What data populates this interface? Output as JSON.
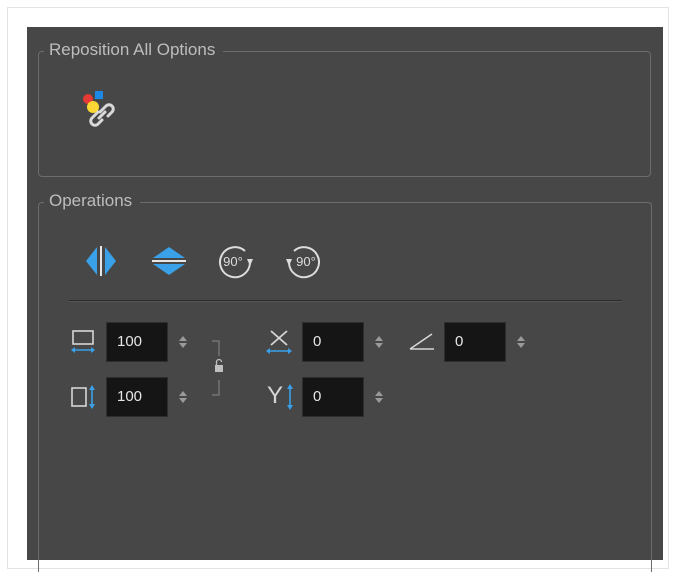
{
  "reposition": {
    "legend": "Reposition All Options",
    "icons": [
      "reposition-all-link-icon"
    ]
  },
  "operations": {
    "legend": "Operations",
    "buttons": [
      "flip-horizontal-icon",
      "flip-vertical-icon",
      "rotate-90-cw-icon",
      "rotate-90-ccw-icon"
    ],
    "rotate_cw_label": "90°",
    "rotate_ccw_label": "90°",
    "width_field": {
      "icon": "width-scale-icon",
      "value": "100"
    },
    "height_field": {
      "icon": "height-scale-icon",
      "value": "100"
    },
    "lock_icon": "lock-ratio-icon",
    "x_offset_field": {
      "icon": "x-offset-icon",
      "value": "0"
    },
    "y_offset_field": {
      "icon": "y-offset-icon",
      "value": "0",
      "label": "Y"
    },
    "angle_field": {
      "icon": "angle-icon",
      "value": "0"
    }
  },
  "colors": {
    "panel_bg": "#474747",
    "accent_blue": "#3aa0e8",
    "field_bg": "#151515",
    "text": "#e6e6e6",
    "legend_text": "#bdbdbd"
  }
}
